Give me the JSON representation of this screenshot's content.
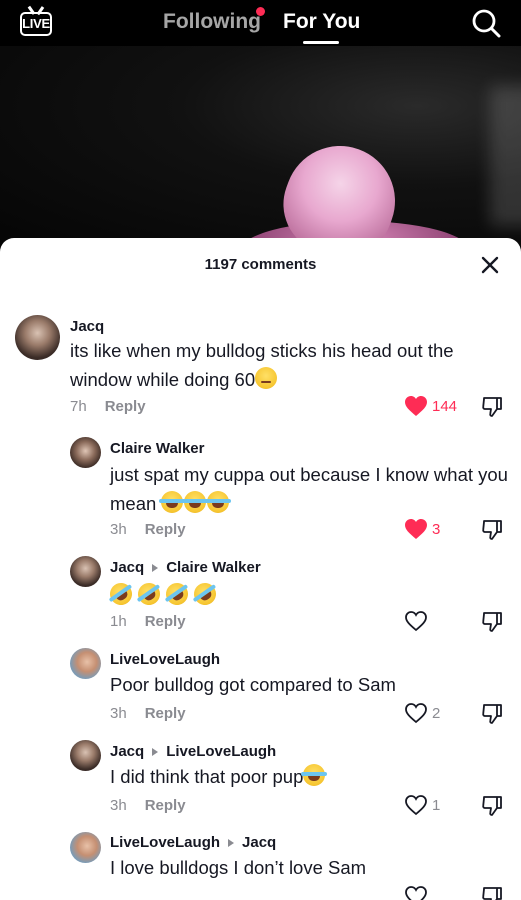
{
  "topbar": {
    "live_label": "LIVE",
    "tabs": [
      {
        "label": "Following",
        "has_notification": true
      },
      {
        "label": "For You",
        "active": true
      }
    ]
  },
  "comments_sheet": {
    "title": "1197 comments",
    "comments": [
      {
        "author": "Jacq",
        "text": "its like when my bulldog sticks his head out the window while doing 60",
        "emoji": [
          "unamused"
        ],
        "time": "7h",
        "reply_label": "Reply",
        "likes": "144",
        "liked": true
      },
      {
        "author": "Claire Walker",
        "text": "just spat my cuppa out because I know what you mean",
        "emoji": [
          "tears-of-joy",
          "tears-of-joy",
          "tears-of-joy"
        ],
        "time": "3h",
        "reply_label": "Reply",
        "likes": "3",
        "liked": true
      },
      {
        "author": "Jacq",
        "reply_to": "Claire Walker",
        "text": "",
        "emoji": [
          "rofl",
          "rofl",
          "rofl",
          "rofl"
        ],
        "time": "1h",
        "reply_label": "Reply",
        "likes": "",
        "liked": false
      },
      {
        "author": "LiveLoveLaugh",
        "text": "Poor bulldog got compared to Sam",
        "time": "3h",
        "reply_label": "Reply",
        "likes": "2",
        "liked": false
      },
      {
        "author": "Jacq",
        "reply_to": "LiveLoveLaugh",
        "text": "I did think that poor pup",
        "emoji": [
          "tears-of-joy"
        ],
        "time": "3h",
        "reply_label": "Reply",
        "likes": "1",
        "liked": false
      },
      {
        "author": "LiveLoveLaugh",
        "reply_to": "Jacq",
        "text": "I love bulldogs I don’t love Sam",
        "time": "",
        "reply_label": "",
        "likes": "",
        "liked": false
      }
    ]
  },
  "colors": {
    "accent_like": "#fe2c55",
    "text_primary": "#161823",
    "text_secondary": "#8a8b91"
  }
}
